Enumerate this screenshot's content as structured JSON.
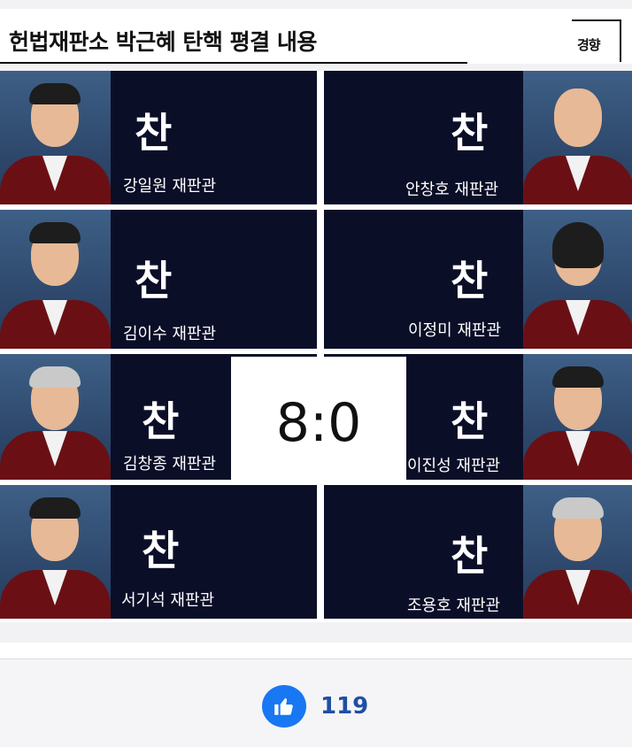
{
  "header": {
    "title": "헌법재판소 박근혜 탄핵 평결 내용",
    "logo_text": "경향"
  },
  "judges": [
    {
      "vote": "찬",
      "name": "강일원 재판관",
      "hair": "dark"
    },
    {
      "vote": "찬",
      "name": "안창호 재판관",
      "hair": "bald"
    },
    {
      "vote": "찬",
      "name": "김이수 재판관",
      "hair": "dark"
    },
    {
      "vote": "찬",
      "name": "이정미 재판관",
      "hair": "bob"
    },
    {
      "vote": "찬",
      "name": "김창종 재판관",
      "hair": "gray"
    },
    {
      "vote": "찬",
      "name": "이진성 재판관",
      "hair": "dark"
    },
    {
      "vote": "찬",
      "name": "서기석 재판관",
      "hair": "dark"
    },
    {
      "vote": "찬",
      "name": "조용호 재판관",
      "hair": "gray"
    }
  ],
  "score": "8:0",
  "footer": {
    "like_count": "119",
    "like_icon": "thumbs-up-icon"
  },
  "colors": {
    "panel": "#0b0e27",
    "robe": "#6a1014",
    "like": "#1877f2",
    "like_text": "#1f4fa3"
  }
}
